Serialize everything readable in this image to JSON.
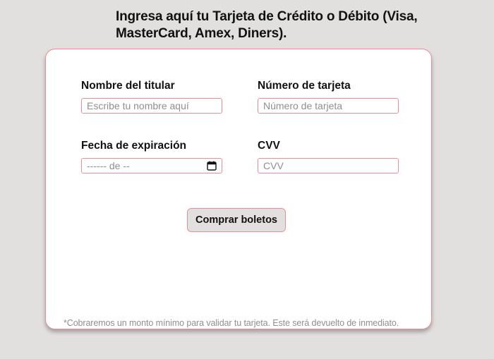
{
  "page": {
    "heading": "Ingresa aquí tu Tarjeta de Crédito o Débito (Visa, MasterCard, Amex, Diners)."
  },
  "form": {
    "fields": [
      {
        "label": "Nombre del titular",
        "placeholder": "Escribe tu nombre aquí",
        "value": ""
      },
      {
        "label": "Número de tarjeta",
        "placeholder": "Número de tarjeta",
        "value": ""
      },
      {
        "label": "Fecha de expiración",
        "display": "------ de --",
        "icon": "calendar-icon"
      },
      {
        "label": "CVV",
        "placeholder": "CVV",
        "value": ""
      }
    ],
    "submit_label": "Comprar boletos",
    "footnote": "*Cobraremos un monto mínimo para validar tu tarjeta. Este será devuelto de inmediato."
  },
  "colors": {
    "background": "#e1e0df",
    "card": "#ffffff",
    "accent_border": "#ee8e94",
    "placeholder": "#8f8f8f",
    "text": "#111111"
  }
}
